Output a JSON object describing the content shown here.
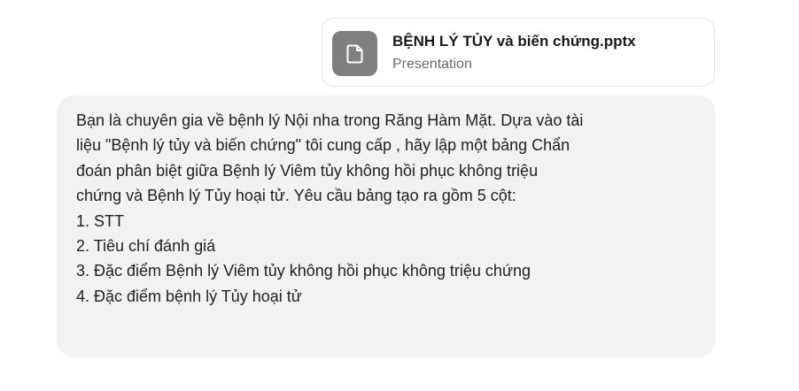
{
  "attachment": {
    "file_name": "BỆNH LÝ TỦY và biến chứng.pptx",
    "file_type": "Presentation",
    "icon": "file-icon"
  },
  "message": {
    "lines": [
      "Bạn là chuyên gia về bệnh lý Nội nha trong Răng Hàm Mặt. Dựa vào tài",
      "liệu \"Bệnh lý tủy và biến chứng\" tôi cung cấp , hãy lập một bảng Chẩn",
      "đoán phân biệt giữa Bệnh lý Viêm tủy không hồi phục không triệu",
      "chứng và Bệnh lý Tủy hoại tử. Yêu cầu bảng tạo ra gồm 5 cột:",
      "1. STT",
      "2. Tiêu chí đánh giá",
      "3. Đặc điểm Bệnh lý Viêm tủy không hồi phục không triệu chứng",
      "4. Đặc điểm bệnh lý Tủy hoại tử"
    ]
  },
  "colors": {
    "bubble_background": "#f2f2f2",
    "icon_background": "#7f7f7f",
    "card_border": "#e3e3e3"
  }
}
